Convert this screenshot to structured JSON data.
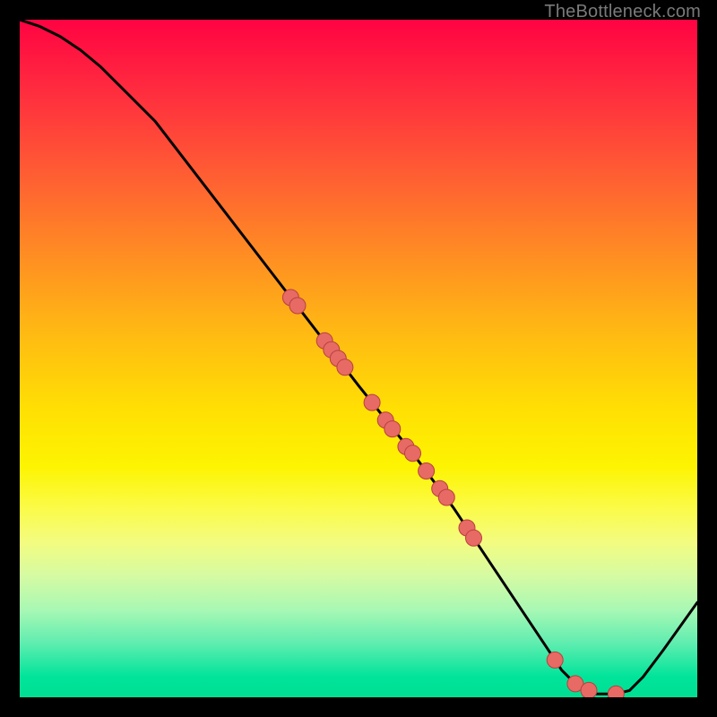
{
  "watermark": "TheBottleneck.com",
  "colors": {
    "curve": "#000000",
    "dot_fill": "#e86a65",
    "dot_stroke": "#b6413f"
  },
  "chart_data": {
    "type": "line",
    "title": "",
    "xlabel": "",
    "ylabel": "",
    "xlim": [
      0,
      100
    ],
    "ylim": [
      0,
      100
    ],
    "series": [
      {
        "name": "bottleneck-curve",
        "x": [
          0,
          3,
          6,
          9,
          12,
          15,
          20,
          30,
          40,
          50,
          58,
          64,
          70,
          74,
          78,
          80,
          82,
          85,
          88,
          90,
          92,
          95,
          100
        ],
        "y": [
          100,
          99,
          97.5,
          95.5,
          93,
          90,
          85,
          72,
          59,
          46,
          36,
          28,
          19,
          13,
          7,
          4,
          2,
          0.5,
          0.5,
          1,
          3,
          7,
          14
        ]
      }
    ],
    "points_on_curve": [
      {
        "x": 40,
        "y": 59
      },
      {
        "x": 41,
        "y": 57.8
      },
      {
        "x": 45,
        "y": 52.6
      },
      {
        "x": 46,
        "y": 51.3
      },
      {
        "x": 47,
        "y": 50
      },
      {
        "x": 48,
        "y": 48.7
      },
      {
        "x": 52,
        "y": 43.5
      },
      {
        "x": 54,
        "y": 40.9
      },
      {
        "x": 55,
        "y": 39.6
      },
      {
        "x": 57,
        "y": 37
      },
      {
        "x": 58,
        "y": 36
      },
      {
        "x": 60,
        "y": 33.4
      },
      {
        "x": 62,
        "y": 30.8
      },
      {
        "x": 63,
        "y": 29.5
      },
      {
        "x": 66,
        "y": 25
      },
      {
        "x": 67,
        "y": 23.5
      },
      {
        "x": 79,
        "y": 5.5
      },
      {
        "x": 82,
        "y": 2
      },
      {
        "x": 84,
        "y": 1
      },
      {
        "x": 88,
        "y": 0.5
      }
    ]
  }
}
